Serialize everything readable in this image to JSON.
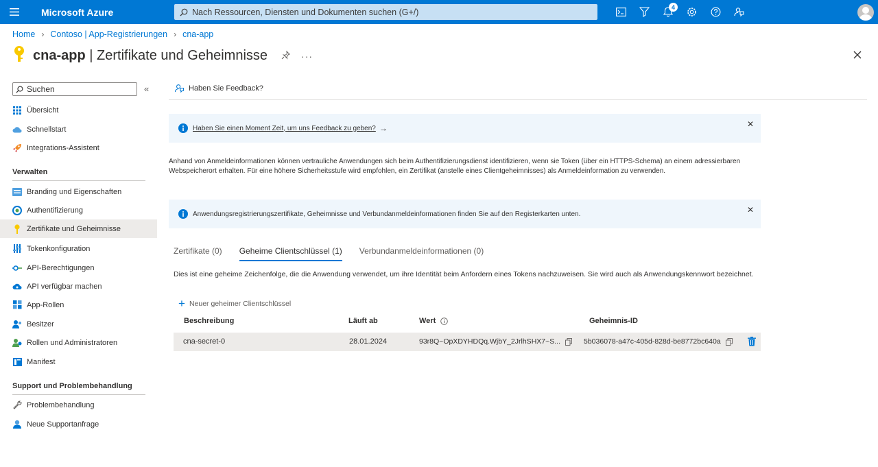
{
  "topbar": {
    "brand": "Microsoft Azure",
    "search_placeholder": "Nach Ressourcen, Diensten und Dokumenten suchen (G+/)",
    "notification_count": "4"
  },
  "breadcrumb": {
    "items": [
      "Home",
      "Contoso | App-Registrierungen",
      "cna-app"
    ]
  },
  "header": {
    "app_name": "cna-app",
    "separator": "|",
    "page_name": "Zertifikate und Geheimnisse"
  },
  "sidebar": {
    "search_placeholder": "Suchen",
    "items": [
      {
        "label": "Übersicht"
      },
      {
        "label": "Schnellstart"
      },
      {
        "label": "Integrations-Assistent"
      }
    ],
    "section_manage": "Verwalten",
    "manage_items": [
      {
        "label": "Branding und Eigenschaften"
      },
      {
        "label": "Authentifizierung"
      },
      {
        "label": "Zertifikate und Geheimnisse"
      },
      {
        "label": "Tokenkonfiguration"
      },
      {
        "label": "API-Berechtigungen"
      },
      {
        "label": "API verfügbar machen"
      },
      {
        "label": "App-Rollen"
      },
      {
        "label": "Besitzer"
      },
      {
        "label": "Rollen und Administratoren"
      },
      {
        "label": "Manifest"
      }
    ],
    "section_support": "Support und Problembehandlung",
    "support_items": [
      {
        "label": "Problembehandlung"
      },
      {
        "label": "Neue Supportanfrage"
      }
    ]
  },
  "main": {
    "feedback_label": "Haben Sie Feedback?",
    "info_feedback": "Haben Sie einen Moment Zeit, um uns Feedback zu geben?",
    "description": "Anhand von Anmeldeinformationen können vertrauliche Anwendungen sich beim Authentifizierungsdienst identifizieren, wenn sie Token (über ein HTTPS-Schema) an einem adressierbaren Webspeicherort erhalten. Für eine höhere Sicherheitsstufe wird empfohlen, ein Zertifikat (anstelle eines Clientgeheimnisses) als Anmeldeinformation zu verwenden.",
    "info_tabs": "Anwendungsregistrierungszertifikate, Geheimnisse und Verbundanmeldeinformationen finden Sie auf den Registerkarten unten.",
    "tabs": [
      {
        "label": "Zertifikate (0)"
      },
      {
        "label": "Geheime Clientschlüssel (1)"
      },
      {
        "label": "Verbundanmeldeinformationen (0)"
      }
    ],
    "tab_description": "Dies ist eine geheime Zeichenfolge, die die Anwendung verwendet, um ihre Identität beim Anfordern eines Tokens nachzuweisen. Sie wird auch als Anwendungskennwort bezeichnet.",
    "new_secret_label": "Neuer geheimer Clientschlüssel",
    "table": {
      "headers": [
        "Beschreibung",
        "Läuft ab",
        "Wert",
        "Geheimnis-ID"
      ],
      "rows": [
        {
          "description": "cna-secret-0",
          "expires": "28.01.2024",
          "value": "93r8Q~OpXDYHDQq.WjbY_2JrlhSHX7~S...",
          "secret_id": "5b036078-a47c-405d-828d-be8772bc640a"
        }
      ]
    }
  },
  "colors": {
    "accent": "#0078d4",
    "info_bg": "#eff6fc",
    "selected_bg": "#edebe9"
  }
}
